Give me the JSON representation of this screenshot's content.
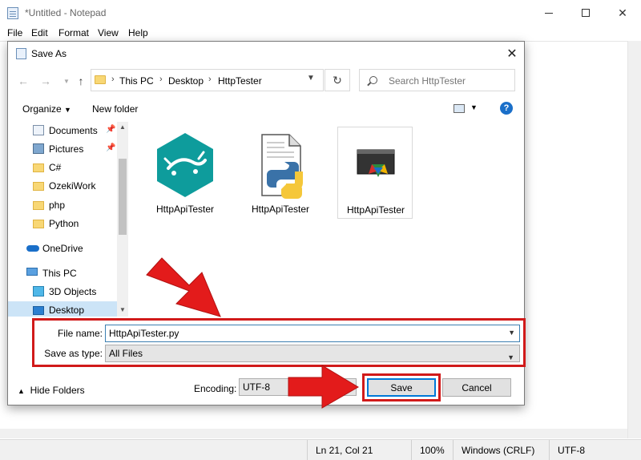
{
  "notepad": {
    "title": "*Untitled - Notepad",
    "menu": [
      "File",
      "Edit",
      "Format",
      "View",
      "Help"
    ],
    "status": {
      "position": "Ln 21, Col 21",
      "zoom": "100%",
      "line_ending": "Windows (CRLF)",
      "encoding": "UTF-8"
    }
  },
  "dialog": {
    "title": "Save As",
    "breadcrumb": [
      "This PC",
      "Desktop",
      "HttpTester"
    ],
    "search_placeholder": "Search HttpTester",
    "toolbar": {
      "organize": "Organize",
      "new_folder": "New folder",
      "help": "?"
    },
    "nav_items": [
      {
        "label": "Documents",
        "pinned": true
      },
      {
        "label": "Pictures",
        "pinned": true
      },
      {
        "label": "C#"
      },
      {
        "label": "OzekiWork"
      },
      {
        "label": "php"
      },
      {
        "label": "Python"
      },
      {
        "label": "OneDrive"
      },
      {
        "label": "This PC"
      },
      {
        "label": "3D Objects"
      },
      {
        "label": "Desktop",
        "selected": true
      }
    ],
    "files": [
      {
        "name": "HttpApiTester",
        "icon": "gecko-app-icon"
      },
      {
        "name": "HttpApiTester",
        "icon": "python-file-icon"
      },
      {
        "name": "HttpApiTester",
        "icon": "app-window-icon"
      }
    ],
    "file_name_label": "File name:",
    "file_name_value": "HttpApiTester.py",
    "save_type_label": "Save as type:",
    "save_type_value": "All Files",
    "hide_folders": "Hide Folders",
    "encoding_label": "Encoding:",
    "encoding_value": "UTF-8",
    "save_label": "Save",
    "cancel_label": "Cancel"
  },
  "colors": {
    "annotation_red": "#d11a1a",
    "accent_blue": "#0078d7",
    "selection": "#cce4f7"
  }
}
